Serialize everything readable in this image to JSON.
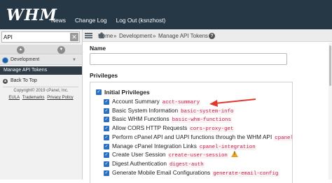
{
  "brand": {
    "logo": "WHM"
  },
  "topnav": {
    "items": [
      "News",
      "Change Log",
      "Log Out (ksnzhost)"
    ]
  },
  "sidebar": {
    "search": {
      "value": "API"
    },
    "category": {
      "label": "Development"
    },
    "active_item": "Manage API Tokens",
    "back_to_top": "Back To Top",
    "copyright": "Copyright© 2019 cPanel, Inc.",
    "links": [
      "EULA",
      "Trademarks",
      "Privacy Policy"
    ]
  },
  "breadcrumb": {
    "items": [
      "Home",
      "Development",
      "Manage API Tokens"
    ],
    "separator": "»"
  },
  "form": {
    "name_label": "Name",
    "name_value": "",
    "privileges_label": "Privileges",
    "group_label": "Initial Privileges",
    "privileges": [
      {
        "label": "Account Summary",
        "code": "acct-summary",
        "warning": false
      },
      {
        "label": "Basic System Information",
        "code": "basic-system-info",
        "warning": false
      },
      {
        "label": "Basic WHM Functions",
        "code": "basic-whm-functions",
        "warning": false
      },
      {
        "label": "Allow CORS HTTP Requests",
        "code": "cors-proxy-get",
        "warning": false
      },
      {
        "label": "Perform cPanel API and UAPI functions through the WHM API",
        "code": "cpanel-api",
        "warning": true
      },
      {
        "label": "Manage cPanel Integration Links",
        "code": "cpanel-integration",
        "warning": false
      },
      {
        "label": "Create User Session",
        "code": "create-user-session",
        "warning": true
      },
      {
        "label": "Digest Authentication",
        "code": "digest-auth",
        "warning": false
      },
      {
        "label": "Generate Mobile Email Configurations",
        "code": "generate-email-config",
        "warning": false
      }
    ]
  },
  "colors": {
    "topbar": "#263746",
    "accent": "#2a6fc1",
    "annotation_arrow": "#e03a2f",
    "code_text": "#c7254e",
    "warning": "#e8a21e"
  },
  "icons": [
    "clear-search-icon",
    "arrow-up-icon",
    "arrow-down-icon",
    "development-icon",
    "back-to-top-icon",
    "hamburger-icon",
    "home-icon",
    "help-icon",
    "warning-icon",
    "annotation-arrow-icon"
  ]
}
